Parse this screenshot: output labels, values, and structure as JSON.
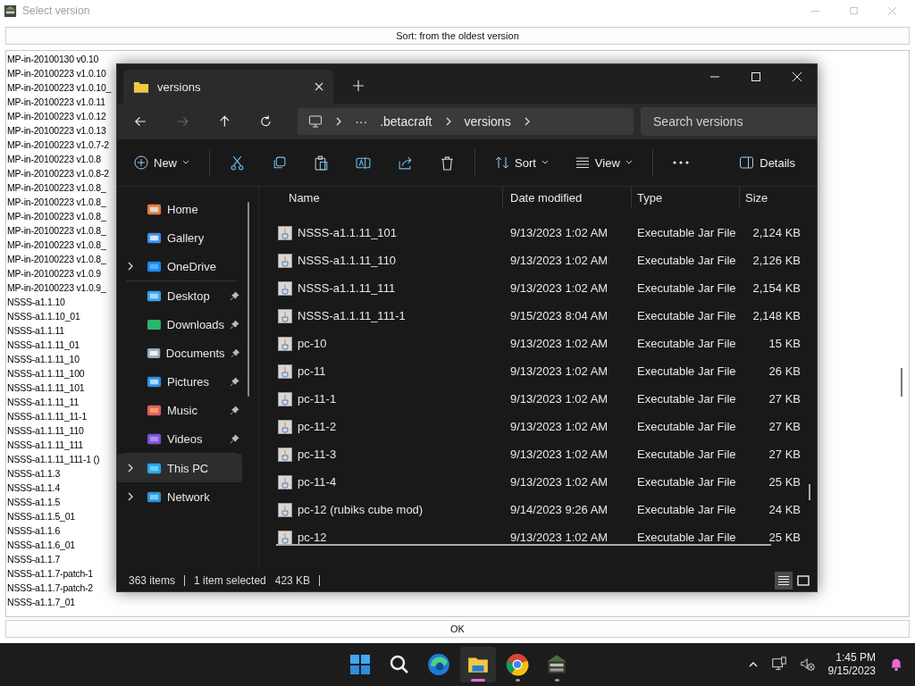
{
  "app_window": {
    "title": "Select version",
    "sort_button": "Sort: from the oldest version",
    "ok_button": "OK",
    "versions": [
      "MP-in-20100130 v0.10",
      "MP-in-20100223 v1.0.10",
      "MP-in-20100223 v1.0.10_",
      "MP-in-20100223 v1.0.11",
      "MP-in-20100223 v1.0.12",
      "MP-in-20100223 v1.0.13",
      "MP-in-20100223 v1.0.7-2",
      "MP-in-20100223 v1.0.8",
      "MP-in-20100223 v1.0.8-2",
      "MP-in-20100223 v1.0.8_",
      "MP-in-20100223 v1.0.8_",
      "MP-in-20100223 v1.0.8_",
      "MP-in-20100223 v1.0.8_",
      "MP-in-20100223 v1.0.8_",
      "MP-in-20100223 v1.0.8_",
      "MP-in-20100223 v1.0.9",
      "MP-in-20100223 v1.0.9_",
      "NSSS-a1.1.10",
      "NSSS-a1.1.10_01",
      "NSSS-a1.1.11",
      "NSSS-a1.1.11_01",
      "NSSS-a1.1.11_10",
      "NSSS-a1.1.11_100",
      "NSSS-a1.1.11_101",
      "NSSS-a1.1.11_11",
      "NSSS-a1.1.11_11-1",
      "NSSS-a1.1.11_110",
      "NSSS-a1.1.11_111",
      "NSSS-a1.1.11_111-1 ()",
      "NSSS-a1.1.3",
      "NSSS-a1.1.4",
      "NSSS-a1.1.5",
      "NSSS-a1.1.5_01",
      "NSSS-a1.1.6",
      "NSSS-a1.1.6_01",
      "NSSS-a1.1.7",
      "NSSS-a1.1.7-patch-1",
      "NSSS-a1.1.7-patch-2",
      "NSSS-a1.1.7_01"
    ]
  },
  "explorer": {
    "tab": {
      "title": "versions"
    },
    "nav": {
      "forward_disabled": true,
      "overflow": "···",
      "breadcrumb": [
        ".betacraft",
        "versions"
      ],
      "search": {
        "placeholder": "Search versions"
      }
    },
    "toolbar": {
      "new": "New",
      "sort": "Sort",
      "view": "View",
      "details": "Details"
    },
    "sidebar": [
      [
        {
          "label": "Home",
          "expandable": false,
          "pinned": false,
          "selected": false
        },
        {
          "label": "Gallery",
          "expandable": false,
          "pinned": false,
          "selected": false
        },
        {
          "label": "OneDrive",
          "expandable": true,
          "pinned": false,
          "selected": false
        }
      ],
      [
        {
          "label": "Desktop",
          "expandable": false,
          "pinned": true,
          "selected": false
        },
        {
          "label": "Downloads",
          "expandable": false,
          "pinned": true,
          "selected": false
        },
        {
          "label": "Documents",
          "expandable": false,
          "pinned": true,
          "selected": false
        },
        {
          "label": "Pictures",
          "expandable": false,
          "pinned": true,
          "selected": false
        },
        {
          "label": "Music",
          "expandable": false,
          "pinned": true,
          "selected": false
        },
        {
          "label": "Videos",
          "expandable": false,
          "pinned": true,
          "selected": false
        }
      ],
      [
        {
          "label": "This PC",
          "expandable": true,
          "pinned": false,
          "selected": true
        },
        {
          "label": "Network",
          "expandable": true,
          "pinned": false,
          "selected": false
        }
      ]
    ],
    "columns": [
      "Name",
      "Date modified",
      "Type",
      "Size"
    ],
    "files": [
      {
        "name": "NSSS-a1.1.11_101",
        "date": "9/13/2023 1:02 AM",
        "type": "Executable Jar File",
        "size": "2,124 KB"
      },
      {
        "name": "NSSS-a1.1.11_110",
        "date": "9/13/2023 1:02 AM",
        "type": "Executable Jar File",
        "size": "2,126 KB"
      },
      {
        "name": "NSSS-a1.1.11_111",
        "date": "9/13/2023 1:02 AM",
        "type": "Executable Jar File",
        "size": "2,154 KB"
      },
      {
        "name": "NSSS-a1.1.11_111-1",
        "date": "9/15/2023 8:04 AM",
        "type": "Executable Jar File",
        "size": "2,148 KB"
      },
      {
        "name": "pc-10",
        "date": "9/13/2023 1:02 AM",
        "type": "Executable Jar File",
        "size": "15 KB"
      },
      {
        "name": "pc-11",
        "date": "9/13/2023 1:02 AM",
        "type": "Executable Jar File",
        "size": "26 KB"
      },
      {
        "name": "pc-11-1",
        "date": "9/13/2023 1:02 AM",
        "type": "Executable Jar File",
        "size": "27 KB"
      },
      {
        "name": "pc-11-2",
        "date": "9/13/2023 1:02 AM",
        "type": "Executable Jar File",
        "size": "27 KB"
      },
      {
        "name": "pc-11-3",
        "date": "9/13/2023 1:02 AM",
        "type": "Executable Jar File",
        "size": "27 KB"
      },
      {
        "name": "pc-11-4",
        "date": "9/13/2023 1:02 AM",
        "type": "Executable Jar File",
        "size": "25 KB"
      },
      {
        "name": "pc-12 (rubiks cube mod)",
        "date": "9/14/2023 9:26 AM",
        "type": "Executable Jar File",
        "size": "24 KB"
      },
      {
        "name": "pc-12",
        "date": "9/13/2023 1:02 AM",
        "type": "Executable Jar File",
        "size": "25 KB"
      }
    ],
    "status": {
      "items": "363 items",
      "selection": "1 item selected",
      "selection_size": "423 KB"
    },
    "views": [
      {
        "selected": true
      },
      {
        "selected": false
      }
    ]
  },
  "taskbar": {
    "apps": [
      {
        "open": false,
        "active": false
      },
      {
        "open": false,
        "active": false
      },
      {
        "open": false,
        "active": false
      },
      {
        "open": true,
        "active": true
      },
      {
        "open": true,
        "active": false
      },
      {
        "open": true,
        "active": false
      }
    ],
    "time": "1:45 PM",
    "date": "9/15/2023"
  }
}
